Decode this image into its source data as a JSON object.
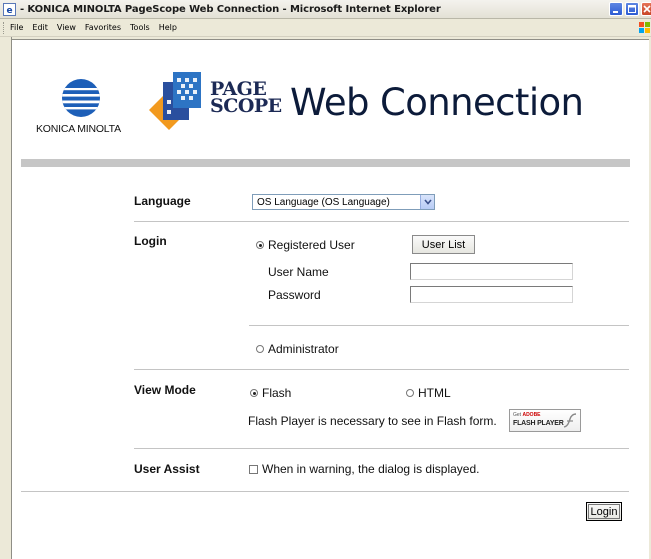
{
  "window": {
    "title": "- KONICA MINOLTA PageScope Web Connection - Microsoft Internet Explorer",
    "menu": [
      "File",
      "Edit",
      "View",
      "Favorites",
      "Tools",
      "Help"
    ]
  },
  "header": {
    "brand": "KONICA MINOLTA",
    "product_line1": "PAGE",
    "product_line2": "SCOPE",
    "product_title": "Web Connection"
  },
  "language": {
    "label": "Language",
    "selected": "OS Language (OS Language)"
  },
  "login": {
    "label": "Login",
    "registered_user": "Registered User",
    "user_list_button": "User List",
    "user_name_label": "User Name",
    "user_name_value": "",
    "password_label": "Password",
    "password_value": "",
    "administrator": "Administrator",
    "selected": "Registered User"
  },
  "view_mode": {
    "label": "View Mode",
    "flash": "Flash",
    "html": "HTML",
    "selected": "Flash",
    "flash_note": "Flash Player is necessary to see in Flash form.",
    "badge_get": "Get",
    "badge_adobe": "ADOBE",
    "badge_player": "FLASH PLAYER"
  },
  "user_assist": {
    "label": "User Assist",
    "checkbox_label": "When in warning, the dialog is displayed.",
    "checked": false
  },
  "footer": {
    "login_button": "Login"
  },
  "colors": {
    "title_text": "#0c1b3a",
    "divider": "#c6c6c6",
    "brand_blue": "#1d5fb8",
    "ps_orange": "#f29a1f"
  }
}
